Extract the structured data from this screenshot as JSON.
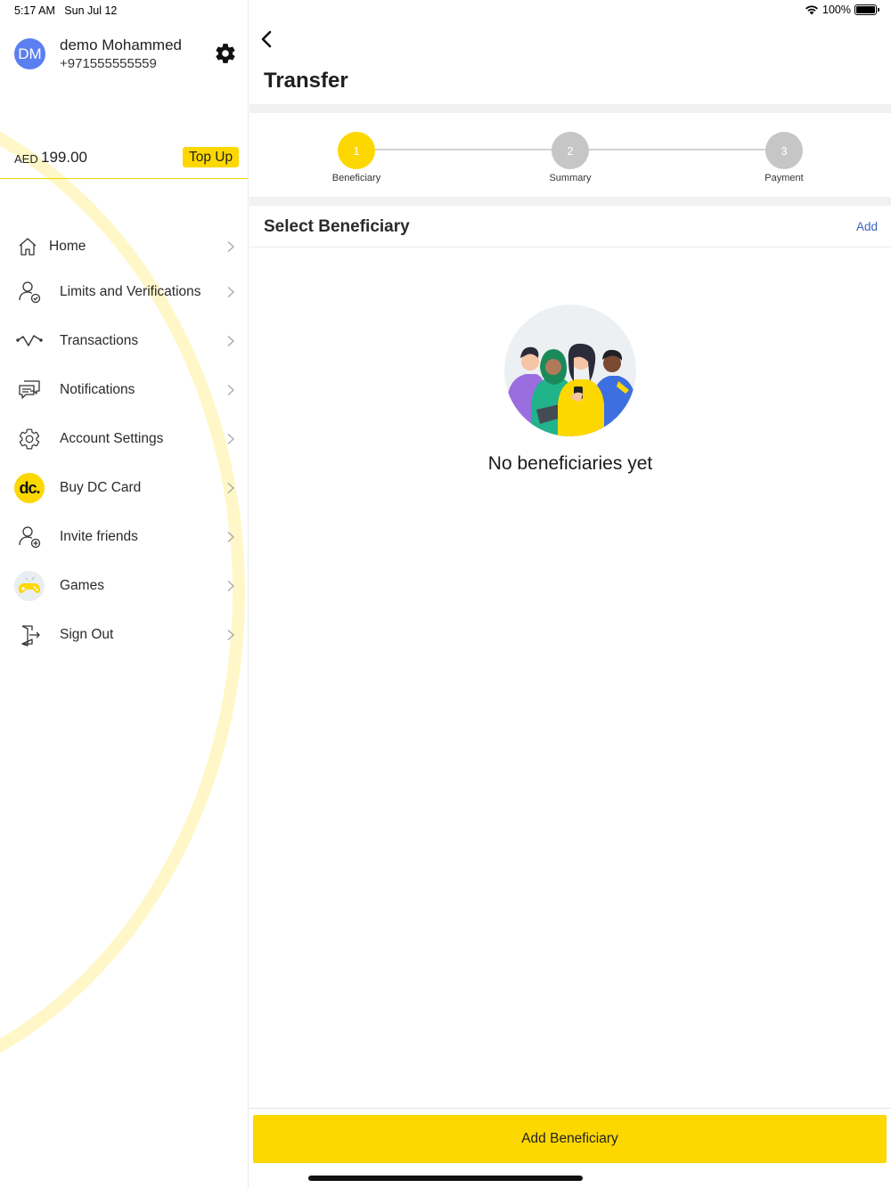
{
  "status_bar": {
    "time": "5:17 AM",
    "date": "Sun Jul 12",
    "battery": "100%"
  },
  "sidebar": {
    "profile": {
      "initials": "DM",
      "name": "demo Mohammed",
      "phone": "+971555555559"
    },
    "balance": {
      "currency": "AED",
      "amount": "199.00",
      "topup_label": "Top Up"
    },
    "menu": [
      {
        "label": "Home",
        "icon": "home-icon"
      },
      {
        "label": "Limits and Verifications",
        "icon": "user-check-icon"
      },
      {
        "label": "Transactions",
        "icon": "activity-icon"
      },
      {
        "label": "Notifications",
        "icon": "chat-icon"
      },
      {
        "label": "Account Settings",
        "icon": "gear-icon"
      },
      {
        "label": "Buy DC Card",
        "icon": "dc-logo-icon"
      },
      {
        "label": "Invite friends",
        "icon": "user-plus-icon"
      },
      {
        "label": "Games",
        "icon": "gamepad-icon"
      },
      {
        "label": "Sign Out",
        "icon": "sign-out-icon"
      }
    ],
    "dc_logo_text": "dc."
  },
  "main": {
    "title": "Transfer",
    "steps": [
      {
        "number": "1",
        "label": "Beneficiary",
        "state": "active"
      },
      {
        "number": "2",
        "label": "Summary",
        "state": "pending"
      },
      {
        "number": "3",
        "label": "Payment",
        "state": "pending"
      }
    ],
    "section_title": "Select Beneficiary",
    "add_link": "Add",
    "empty_text": "No beneficiaries yet",
    "primary_button": "Add Beneficiary"
  },
  "colors": {
    "accent": "#fcd800",
    "avatar": "#5b7ff0",
    "link": "#3a63c7",
    "step_pending": "#c6c6c6"
  }
}
